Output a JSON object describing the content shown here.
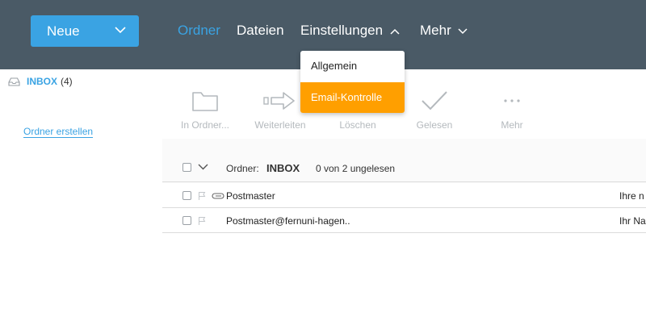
{
  "header": {
    "new_button": {
      "label": "Neue"
    },
    "nav": [
      {
        "label": "Ordner",
        "active": true
      },
      {
        "label": "Dateien"
      },
      {
        "label": "Einstellungen"
      },
      {
        "label": "Mehr"
      }
    ]
  },
  "settings_menu": {
    "items": [
      {
        "label": "Allgemein"
      },
      {
        "label": "Email-Kontrolle",
        "highlighted": true
      }
    ]
  },
  "sidebar": {
    "inbox": {
      "name": "INBOX",
      "count": "(4)"
    },
    "create_folder": "Ordner erstellen"
  },
  "toolbar": [
    {
      "label": "In Ordner...",
      "icon": "folder-icon"
    },
    {
      "label": "Weiterleiten",
      "icon": "forward-arrow-icon"
    },
    {
      "label": "Löschen",
      "icon": "trash-icon"
    },
    {
      "label": "Gelesen",
      "icon": "checkmark-icon"
    },
    {
      "label": "Mehr",
      "icon": "more-dots-icon"
    }
  ],
  "list_header": {
    "folder_label": "Ordner:",
    "folder_name": "INBOX",
    "unread": "0 von 2 ungelesen"
  },
  "messages": [
    {
      "sender": "Postmaster",
      "subject": "Ihre n",
      "attachment": true
    },
    {
      "sender": "Postmaster@fernuni-hagen..",
      "subject": "Ihr Na",
      "attachment": false
    }
  ],
  "colors": {
    "topbar": "#4a5a66",
    "accent": "#3aa3e3",
    "highlight": "#ff9f00"
  }
}
